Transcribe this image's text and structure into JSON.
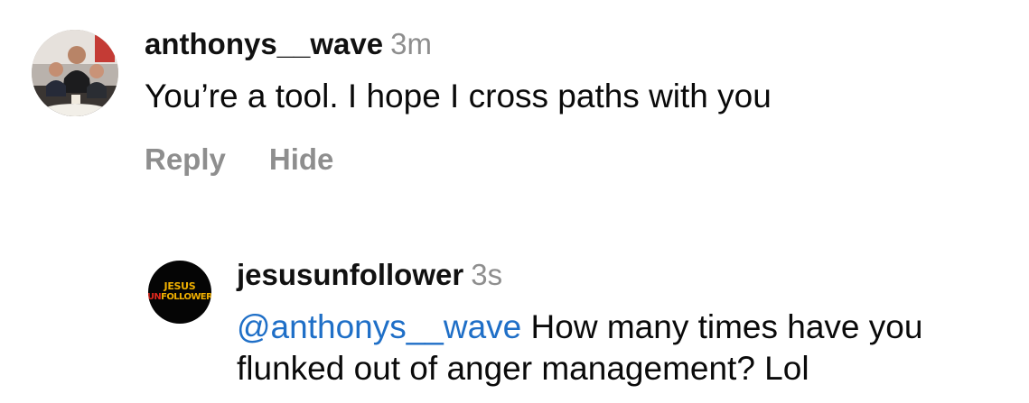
{
  "comments": [
    {
      "username": "anthonys__wave",
      "time": "3m",
      "text": "You’re a tool. I hope I cross paths with you",
      "actions": [
        "Reply",
        "Hide"
      ]
    },
    {
      "username": "jesusunfollower",
      "time": "3s",
      "mention": "@anthonys__wave",
      "text": " How many times have you flunked out of anger management? Lol",
      "avatar_logo": {
        "line1": "JESUS",
        "line2_prefix": "UN",
        "line2_rest": "FOLLOWER"
      }
    }
  ],
  "colors": {
    "mention": "#1f6fc7",
    "muted": "#8e8e8e",
    "logo_yellow": "#f0b000",
    "logo_red": "#e0281e"
  }
}
